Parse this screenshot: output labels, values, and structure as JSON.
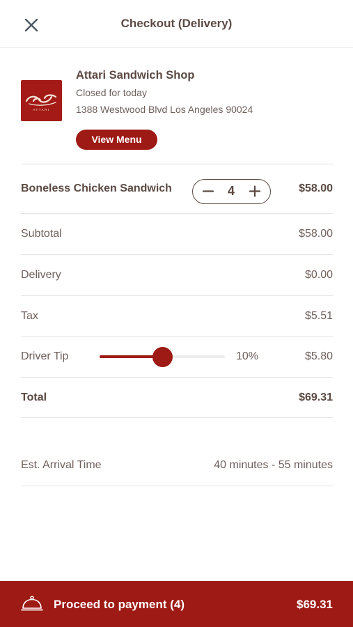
{
  "header": {
    "title": "Checkout (Delivery)",
    "close_icon": "close-icon"
  },
  "shop": {
    "name": "Attari Sandwich Shop",
    "status": "Closed for today",
    "address": "1388 Westwood Blvd Los Angeles 90024",
    "view_menu_label": "View Menu",
    "logo_text": "ATTARI"
  },
  "item": {
    "name": "Boneless Chicken Sandwich",
    "quantity": "4",
    "price": "$58.00",
    "minus_icon": "minus-icon",
    "plus_icon": "plus-icon"
  },
  "summary": {
    "subtotal_label": "Subtotal",
    "subtotal": "$58.00",
    "delivery_label": "Delivery",
    "delivery": "$0.00",
    "tax_label": "Tax",
    "tax": "$5.51",
    "tip_label": "Driver Tip",
    "tip_percent_text": "10%",
    "tip_slider_fraction": 0.5,
    "tip": "$5.80",
    "total_label": "Total",
    "total": "$69.31"
  },
  "arrival": {
    "label": "Est. Arrival Time",
    "value": "40 minutes - 55 minutes"
  },
  "footer": {
    "label": "Proceed to payment (4)",
    "total": "$69.31",
    "icon": "cloche-icon"
  },
  "colors": {
    "accent": "#9e1a15",
    "text": "#5b4a43",
    "divider": "#e3e3e3"
  }
}
